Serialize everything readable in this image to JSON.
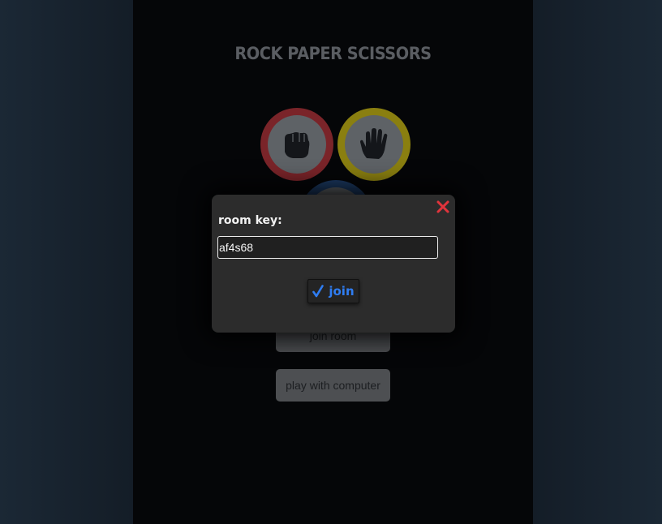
{
  "game": {
    "title": "ROCK PAPER SCISSORS",
    "choices": [
      {
        "name": "rock",
        "ring_color": "#7a2429",
        "icon": "fist-icon"
      },
      {
        "name": "paper",
        "ring_color": "#8a7f10",
        "icon": "open-hand-icon"
      },
      {
        "name": "scissors",
        "ring_color": "#1c3a63",
        "icon": "scissors-hand-icon"
      }
    ]
  },
  "menu": {
    "join_room_label": "join room",
    "play_computer_label": "play with computer"
  },
  "modal": {
    "label": "room key:",
    "room_key_value": "af4s68",
    "join_label": "join",
    "join_icon": "checkmark-icon",
    "close_icon": "close-icon",
    "close_color": "#e0343c",
    "accent_color": "#2f7df2"
  }
}
